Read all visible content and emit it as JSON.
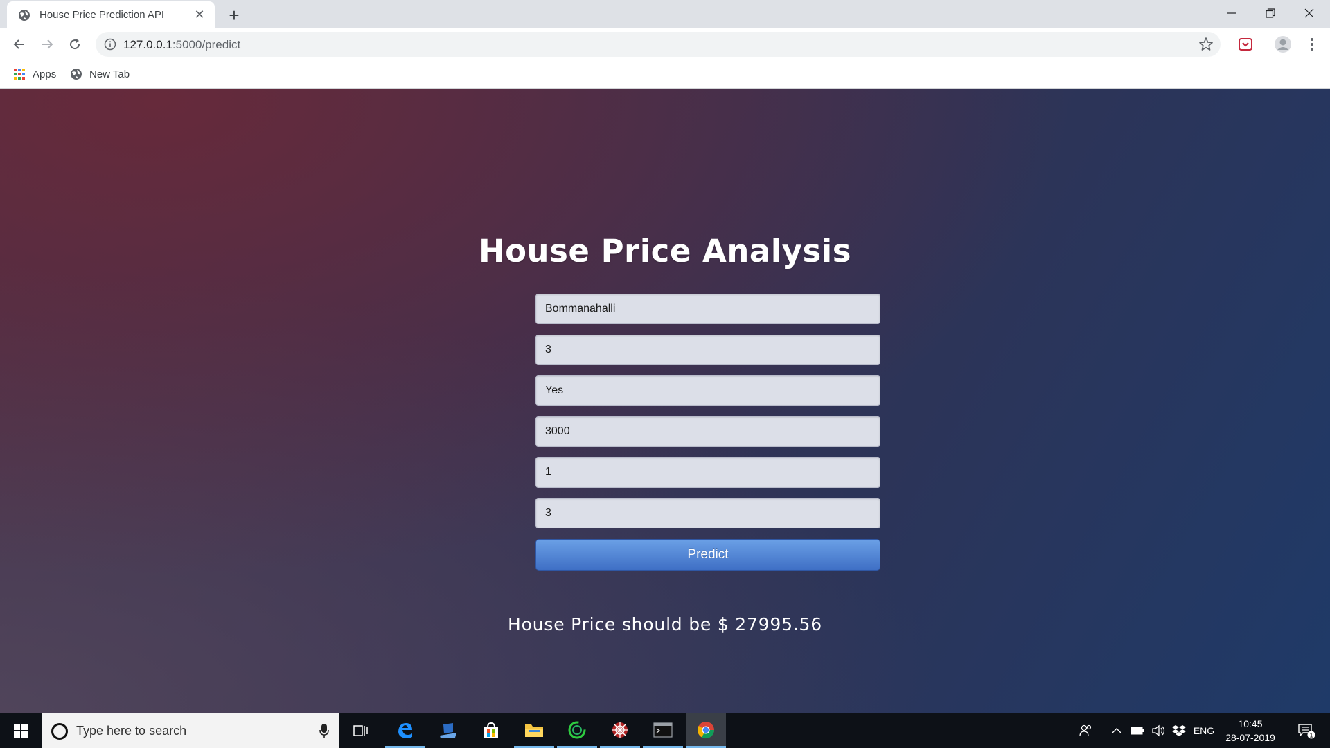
{
  "browser": {
    "tab_title": "House Price Prediction API",
    "new_tab_label": "+",
    "url_host": "127.0.0.1",
    "url_path": ":5000/predict",
    "bookmarks": [
      {
        "label": "Apps",
        "icon": "apps-grid-icon"
      },
      {
        "label": "New Tab",
        "icon": "globe-icon"
      }
    ]
  },
  "page": {
    "title": "House Price Analysis",
    "fields": [
      {
        "value": "Bommanahalli",
        "name": "location-field"
      },
      {
        "value": "3",
        "name": "bhk-field"
      },
      {
        "value": "Yes",
        "name": "availability-field"
      },
      {
        "value": "3000",
        "name": "total-sqft-field"
      },
      {
        "value": "1",
        "name": "balcony-field"
      },
      {
        "value": "3",
        "name": "bath-field"
      }
    ],
    "predict_label": "Predict",
    "result_text": "House Price should be $ 27995.56"
  },
  "taskbar": {
    "search_placeholder": "Type here to search",
    "language": "ENG",
    "time": "10:45",
    "date": "28-07-2019",
    "notification_count": "1"
  },
  "colors": {
    "accent_button": "#4a7fd4",
    "field_bg": "#dcdfe8"
  }
}
